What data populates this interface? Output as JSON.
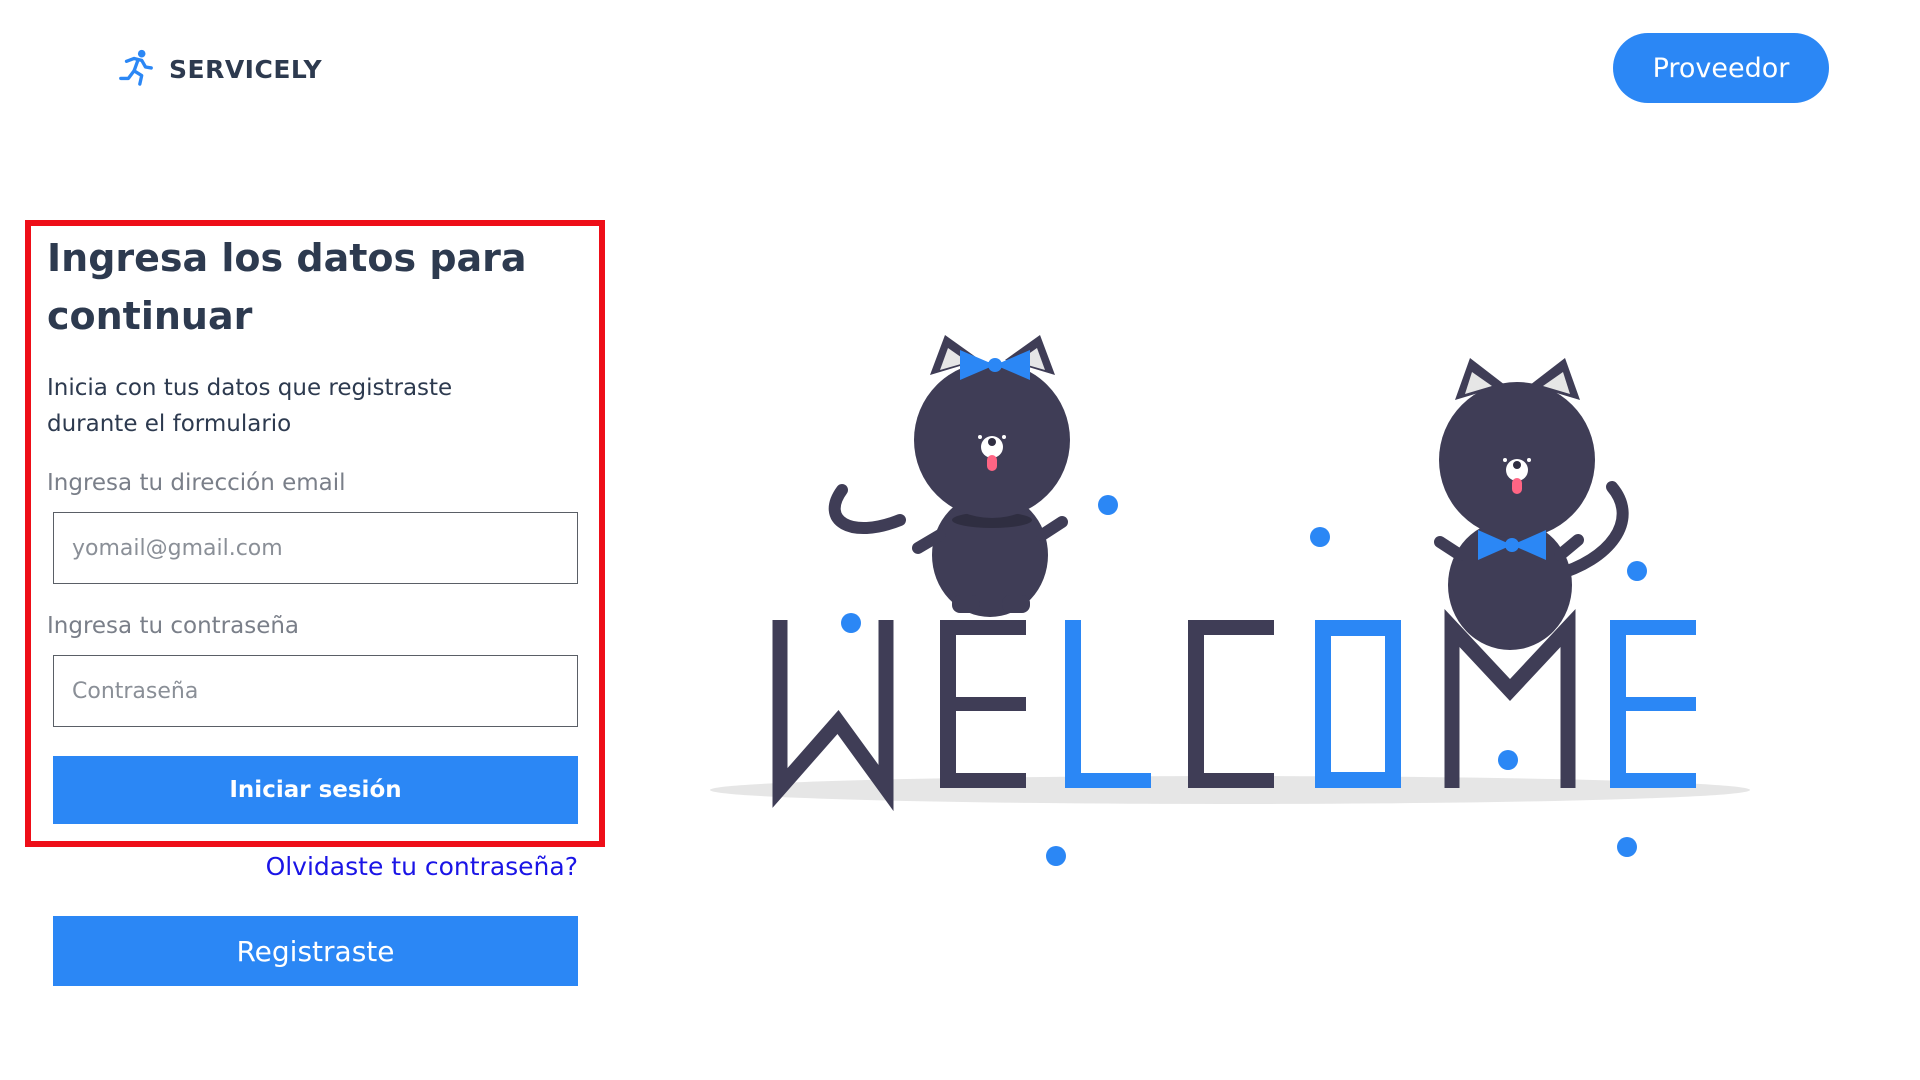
{
  "header": {
    "logo_text": "SERVICELY",
    "provider_button": "Proveedor"
  },
  "login": {
    "title": "Ingresa los datos para continuar",
    "subtitle": "Inicia con tus datos que registraste durante el formulario",
    "email_label": "Ingresa tu dirección email",
    "email_placeholder": "yomail@gmail.com",
    "email_value": "",
    "password_label": "Ingresa tu contraseña",
    "password_placeholder": "Contraseña",
    "password_value": "",
    "submit_button": "Iniciar sesión",
    "forgot_link": "Olvidaste tu contraseña?",
    "register_button": "Registraste"
  },
  "illustration": {
    "word": "WELCOME",
    "icon": "welcome-cats-illustration"
  },
  "colors": {
    "accent": "#2b87f5",
    "dark": "#3f3d56",
    "highlight_border": "#ee0e18",
    "link": "#1a14e6"
  }
}
